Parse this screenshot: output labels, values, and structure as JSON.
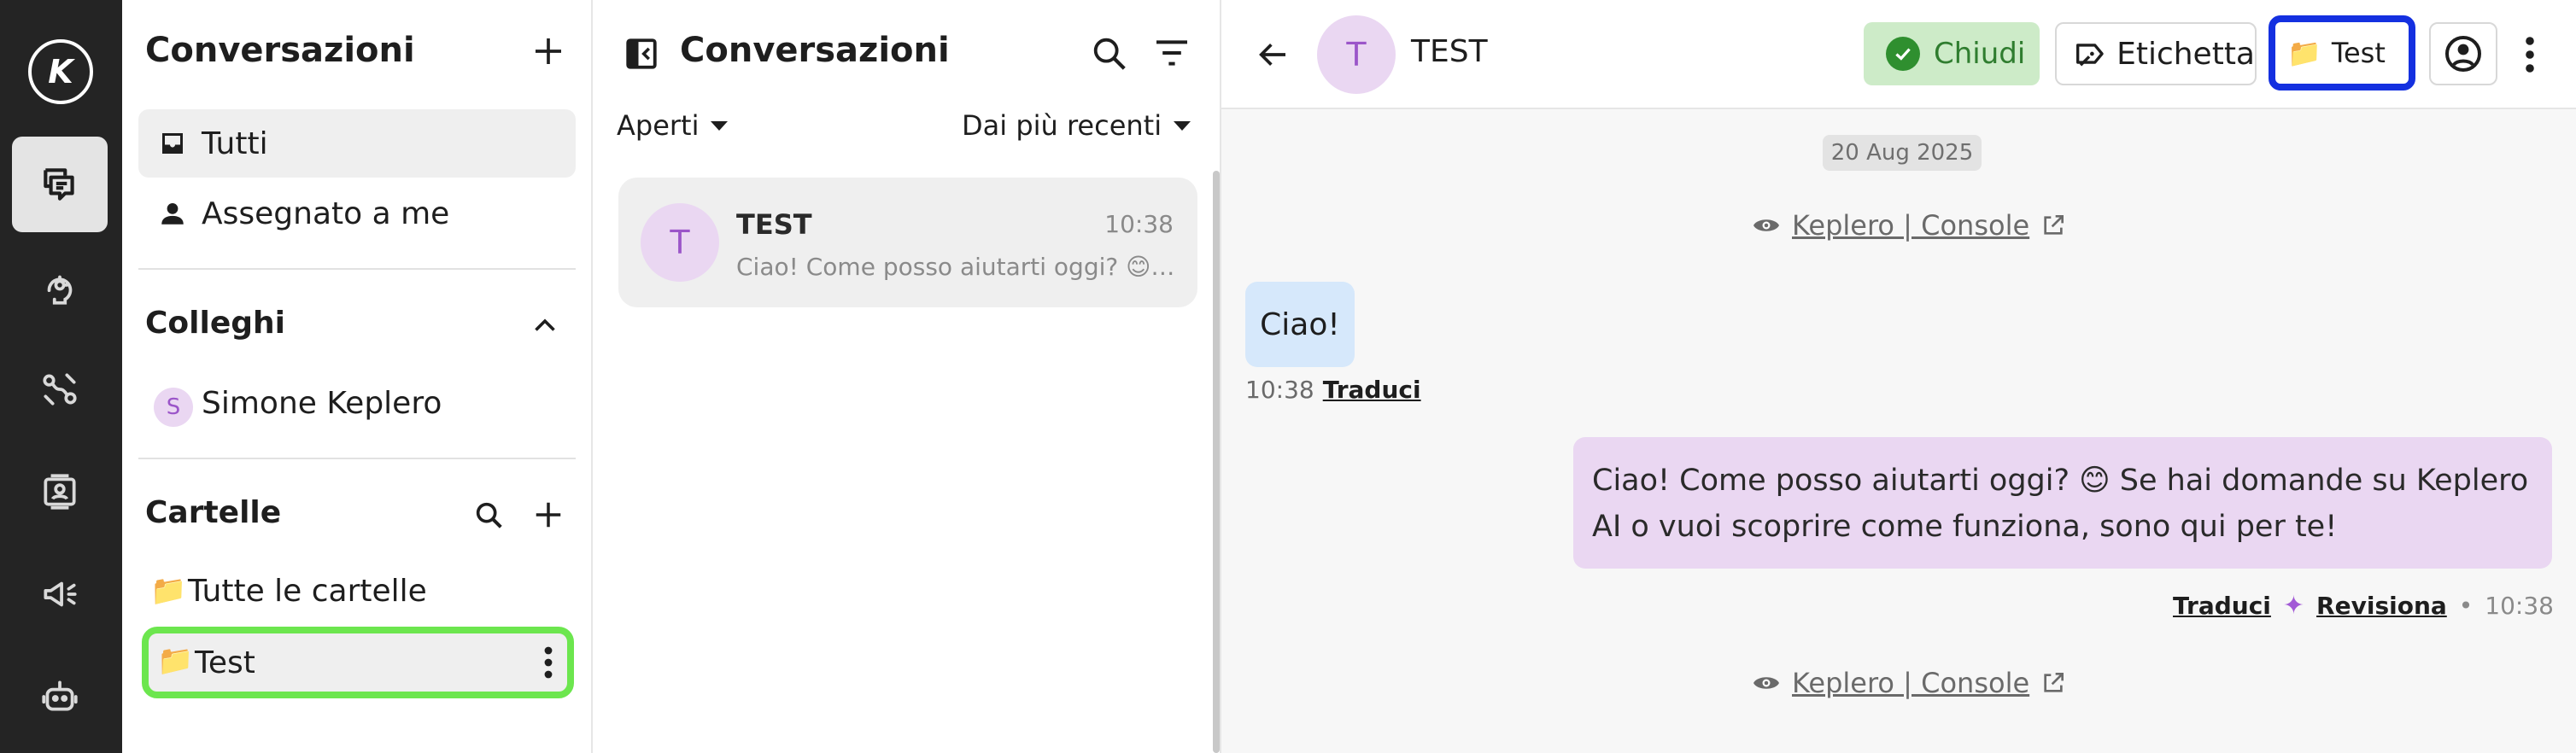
{
  "rail": {
    "logo_letter": "K",
    "icons": [
      "brand-logo-icon",
      "chat-icon",
      "agents-icon",
      "integrations-icon",
      "contacts-icon",
      "campaigns-icon",
      "bot-icon"
    ],
    "active": "chat-icon"
  },
  "sidebar": {
    "title": "Conversazioni",
    "nav": [
      {
        "label": "Tutti",
        "icon": "inbox-icon",
        "selected": true
      },
      {
        "label": "Assegnato a me",
        "icon": "person-icon",
        "selected": false
      }
    ],
    "colleagues": {
      "title": "Colleghi",
      "items": [
        {
          "label": "Simone Keplero",
          "initial": "S"
        }
      ]
    },
    "folders": {
      "title": "Cartelle",
      "items": [
        {
          "label": "Tutte le cartelle",
          "icon": "📁"
        },
        {
          "label": "Test",
          "icon": "📁",
          "selected": true
        }
      ]
    }
  },
  "convlist": {
    "title": "Conversazioni",
    "status_filter": "Aperti",
    "sort": "Dai più recenti",
    "conversations": [
      {
        "initial": "T",
        "name": "TEST",
        "time": "10:38",
        "preview": "Ciao! Come posso aiutarti oggi? 😊 Se hai domande su Keplero AI o vuoi scoprire come funziona, sono qui per te!"
      }
    ]
  },
  "chat": {
    "contact_initial": "T",
    "contact_name": "TEST",
    "close_label": "Chiudi",
    "label_button": "Etichetta",
    "folder_button": "Test",
    "folder_icon": "📁",
    "date": "20 Aug 2025",
    "source_link": "Keplero | Console",
    "messages": [
      {
        "direction": "in",
        "text": "Ciao!",
        "time": "10:38",
        "translate": "Traduci"
      },
      {
        "direction": "out",
        "text": "Ciao! Come posso aiutarti oggi? 😊 Se hai domande su Keplero AI o vuoi scoprire come funziona, sono qui per te!",
        "time": "10:38",
        "translate": "Traduci",
        "review": "Revisiona",
        "separator": "•"
      }
    ],
    "colors": {
      "close_bg": "#cdebc8",
      "highlight_blue": "#1430e0",
      "highlight_green": "#6ce64e",
      "bot_bubble": "#ead7f2",
      "user_bubble": "#d6e8fb"
    }
  }
}
